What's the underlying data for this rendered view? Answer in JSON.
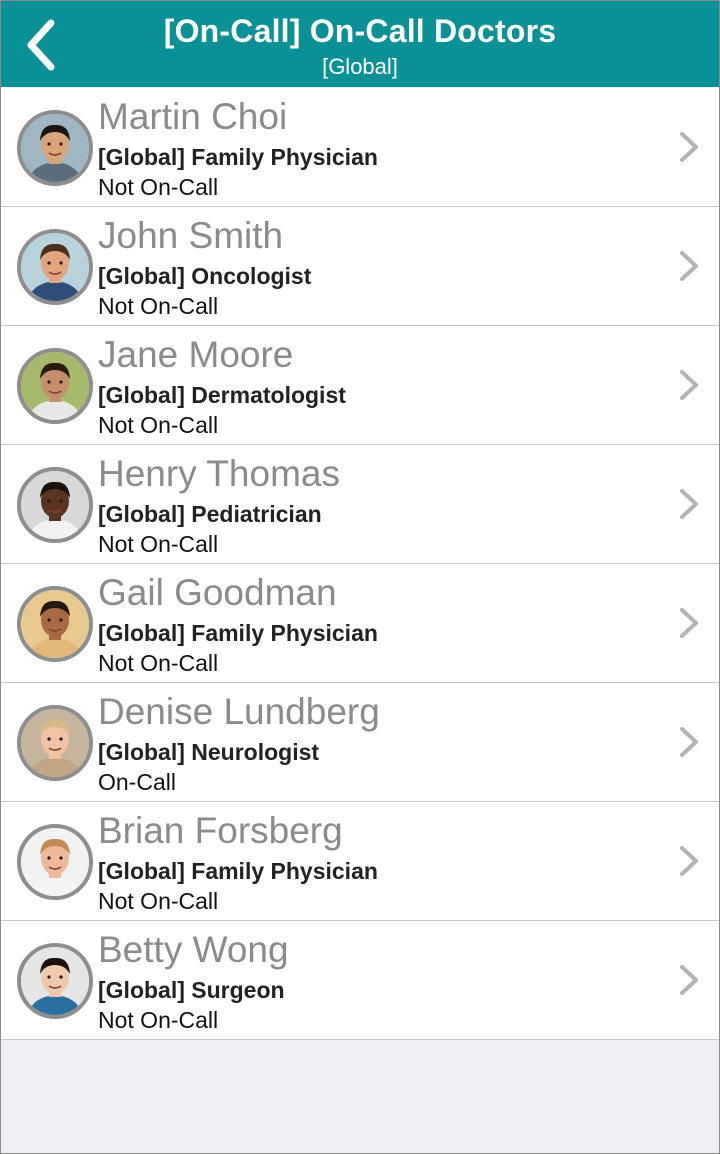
{
  "header": {
    "title": "[On-Call] On-Call Doctors",
    "subtitle": "[Global]",
    "back_icon": "chevron-left-icon",
    "background": "#0a9196"
  },
  "doctors": [
    {
      "name": "Martin Choi",
      "role": "[Global] Family Physician",
      "status": "Not On-Call",
      "skin": "#d9a47a",
      "hair": "#1b1410",
      "shirt": "#5b6d7c",
      "bg": "#9fb7c4"
    },
    {
      "name": "John Smith",
      "role": "[Global] Oncologist",
      "status": "Not On-Call",
      "skin": "#e2a47f",
      "hair": "#4a2f1e",
      "shirt": "#2f4f7a",
      "bg": "#b9d3dd"
    },
    {
      "name": "Jane Moore",
      "role": "[Global] Dermatologist",
      "status": "Not On-Call",
      "skin": "#c48f6c",
      "hair": "#2a1a12",
      "shirt": "#e8e8e8",
      "bg": "#a7b96c"
    },
    {
      "name": "Henry Thomas",
      "role": "[Global] Pediatrician",
      "status": "Not On-Call",
      "skin": "#5a3422",
      "hair": "#1b100b",
      "shirt": "#f2f2f2",
      "bg": "#d8d8d8"
    },
    {
      "name": "Gail Goodman",
      "role": "[Global] Family Physician",
      "status": "Not On-Call",
      "skin": "#a86a45",
      "hair": "#24160f",
      "shirt": "#e3b97b",
      "bg": "#e8c98f"
    },
    {
      "name": "Denise Lundberg",
      "role": "[Global] Neurologist",
      "status": "On-Call",
      "skin": "#efc3a4",
      "hair": "#d8b98c",
      "shirt": "#c4a585",
      "bg": "#c7b59e"
    },
    {
      "name": "Brian Forsberg",
      "role": "[Global] Family Physician",
      "status": "Not On-Call",
      "skin": "#f0b89a",
      "hair": "#c28a56",
      "shirt": "#f4f4f4",
      "bg": "#f2f2f2"
    },
    {
      "name": "Betty Wong",
      "role": "[Global] Surgeon",
      "status": "Not On-Call",
      "skin": "#efc9ad",
      "hair": "#1c1310",
      "shirt": "#2b6fa0",
      "bg": "#e6e6e6"
    }
  ],
  "row_chevron_icon": "chevron-right-icon",
  "avatar_icon": "doctor-avatar-icon"
}
